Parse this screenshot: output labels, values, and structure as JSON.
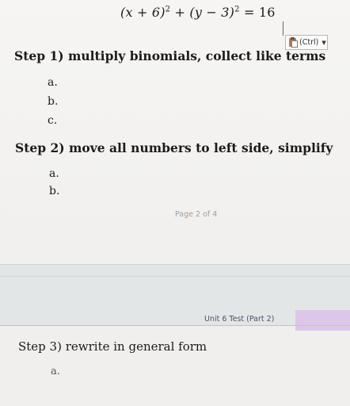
{
  "document": {
    "equation": {
      "part1": "(x + 6)",
      "exp1": "2",
      "plus": " + ",
      "part2": "(y − 3)",
      "exp2": "2",
      "rhs": " = 16"
    },
    "paste_options": {
      "label": "(Ctrl)",
      "icon": "clipboard-paste-icon"
    },
    "steps": [
      {
        "title": "Step 1) multiply binomials, collect like terms",
        "items": [
          "a.",
          "b.",
          "c."
        ]
      },
      {
        "title": "Step 2) move all numbers to left side, simplify",
        "items": [
          "a.",
          "b."
        ]
      },
      {
        "title": "Step 3) rewrite in general form",
        "items": [
          "a."
        ]
      }
    ],
    "page_indicator": "Page 2 of 4",
    "footer_label": "Unit 6 Test (Part 2)",
    "colors": {
      "footer_swatch": "#ddc6ea",
      "page_number": "#9aa0a6"
    }
  }
}
